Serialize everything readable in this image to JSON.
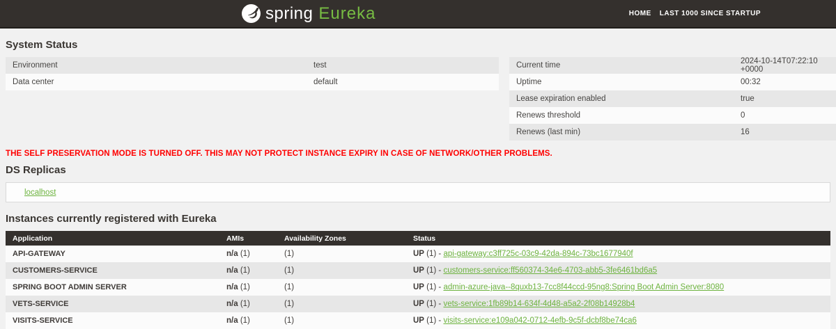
{
  "header": {
    "brand": {
      "spring": "spring",
      "eureka": "Eureka"
    },
    "nav": [
      {
        "label": "HOME"
      },
      {
        "label": "LAST 1000 SINCE STARTUP"
      }
    ]
  },
  "system_status": {
    "title": "System Status",
    "left_rows": [
      {
        "label": "Environment",
        "value": "test"
      },
      {
        "label": "Data center",
        "value": "default"
      }
    ],
    "right_rows": [
      {
        "label": "Current time",
        "value": "2024-10-14T07:22:10 +0000"
      },
      {
        "label": "Uptime",
        "value": "00:32"
      },
      {
        "label": "Lease expiration enabled",
        "value": "true"
      },
      {
        "label": "Renews threshold",
        "value": "0"
      },
      {
        "label": "Renews (last min)",
        "value": "16"
      }
    ]
  },
  "warning": "THE SELF PRESERVATION MODE IS TURNED OFF. THIS MAY NOT PROTECT INSTANCE EXPIRY IN CASE OF NETWORK/OTHER PROBLEMS.",
  "ds_replicas": {
    "title": "DS Replicas",
    "replicas": [
      {
        "label": "localhost"
      }
    ]
  },
  "instances": {
    "title": "Instances currently registered with Eureka",
    "columns": [
      "Application",
      "AMIs",
      "Availability Zones",
      "Status"
    ],
    "rows": [
      {
        "application": "API-GATEWAY",
        "amis": "n/a",
        "amis_rest": " (1)",
        "zones": "(1)",
        "status": "UP",
        "status_rest": " (1) - ",
        "instance": "api-gateway:c3ff725c-03c9-42da-894c-73bc1677940f"
      },
      {
        "application": "CUSTOMERS-SERVICE",
        "amis": "n/a",
        "amis_rest": " (1)",
        "zones": "(1)",
        "status": "UP",
        "status_rest": " (1) - ",
        "instance": "customers-service:ff560374-34e6-4703-abb5-3fe6461bd6a5"
      },
      {
        "application": "SPRING BOOT ADMIN SERVER",
        "amis": "n/a",
        "amis_rest": " (1)",
        "zones": "(1)",
        "status": "UP",
        "status_rest": " (1) - ",
        "instance": "admin-azure-java--8quxb13-7cc8f44ccd-95ng8:Spring Boot Admin Server:8080"
      },
      {
        "application": "VETS-SERVICE",
        "amis": "n/a",
        "amis_rest": " (1)",
        "zones": "(1)",
        "status": "UP",
        "status_rest": " (1) - ",
        "instance": "vets-service:1fb89b14-634f-4d48-a5a2-2f08b14928b4"
      },
      {
        "application": "VISITS-SERVICE",
        "amis": "n/a",
        "amis_rest": " (1)",
        "zones": "(1)",
        "status": "UP",
        "status_rest": " (1) - ",
        "instance": "visits-service:e109a042-0712-4efb-9c5f-dcbf8be74ca6"
      }
    ]
  },
  "colors": {
    "banner_bg": "#34302d",
    "accent_green": "#6db33f",
    "eureka_green": "#77bc43",
    "warning_red": "#ff0000",
    "stripe_gray": "#e7e7e7"
  }
}
